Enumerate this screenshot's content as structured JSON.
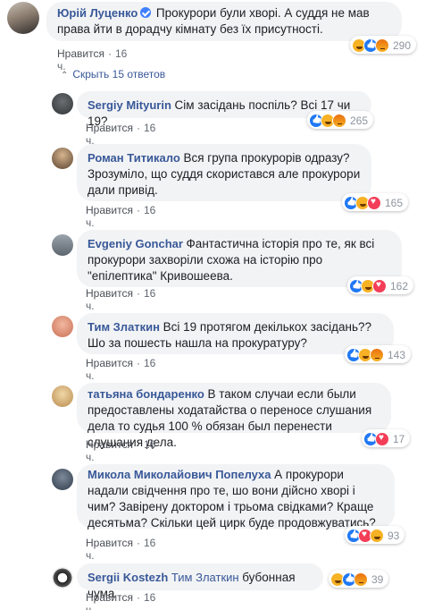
{
  "main_comment": {
    "author": "Юрій Луценко",
    "text": "Прокурори були хворі. А суддя не мав права йти в дорадчу кімнату без їх присутності.",
    "like": "Нравится",
    "time": "16 ч.",
    "reaction_count": "290"
  },
  "hide_replies_label": "Скрыть 15 ответов",
  "replies": [
    {
      "author": "Sergiy Mityurin",
      "text": "Сім засідань поспіль? Всі 17 чи 19?",
      "like": "Нравится",
      "time": "16 ч.",
      "reaction_count": "265"
    },
    {
      "author": "Роман Титикало",
      "text": "Вся група прокурорів одразу? Зрозуміло, що суддя скористався але прокурори дали привід.",
      "like": "Нравится",
      "time": "16 ч.",
      "reaction_count": "165"
    },
    {
      "author": "Evgeniy Gonchar",
      "text": "Фантастична історія про те, як всі прокурори захворіли схожа на історію про \"епілептика\" Кривошеева.",
      "like": "Нравится",
      "time": "16 ч.",
      "reaction_count": "162"
    },
    {
      "author": "Тим Златкин",
      "text": "Всі 19 протягом декількох засідань?? Шо за пошесть нашла на прокуратуру?",
      "like": "Нравится",
      "time": "16 ч.",
      "reaction_count": "143"
    },
    {
      "author": "татьяна бондаренко",
      "text": "В таком случаи если были предоставлены ходатайства о переносе слушания дела то судья 100 % обязан был перенести слушания дела.",
      "like": "Нравится",
      "time": "16 ч.",
      "reaction_count": "17"
    },
    {
      "author": "Микола Миколайович Попелуха",
      "text": "А прокурори надали свідчення про те, шо вони дійсно хворі і чим? Завірену доктором і трьома свідками? Краще десятьма? Скільки цей цирк буде продовжуватись?",
      "like": "Нравится",
      "time": "16 ч.",
      "reaction_count": "93"
    },
    {
      "author": "Sergii Kostezh",
      "mention": "Тим Златкин",
      "text": "бубонная чума",
      "like": "Нравится",
      "time": "16 ч.",
      "reaction_count": "39"
    }
  ],
  "colors": {
    "name": "#385898",
    "bubble": "#f2f3f5",
    "meta": "#606770"
  }
}
